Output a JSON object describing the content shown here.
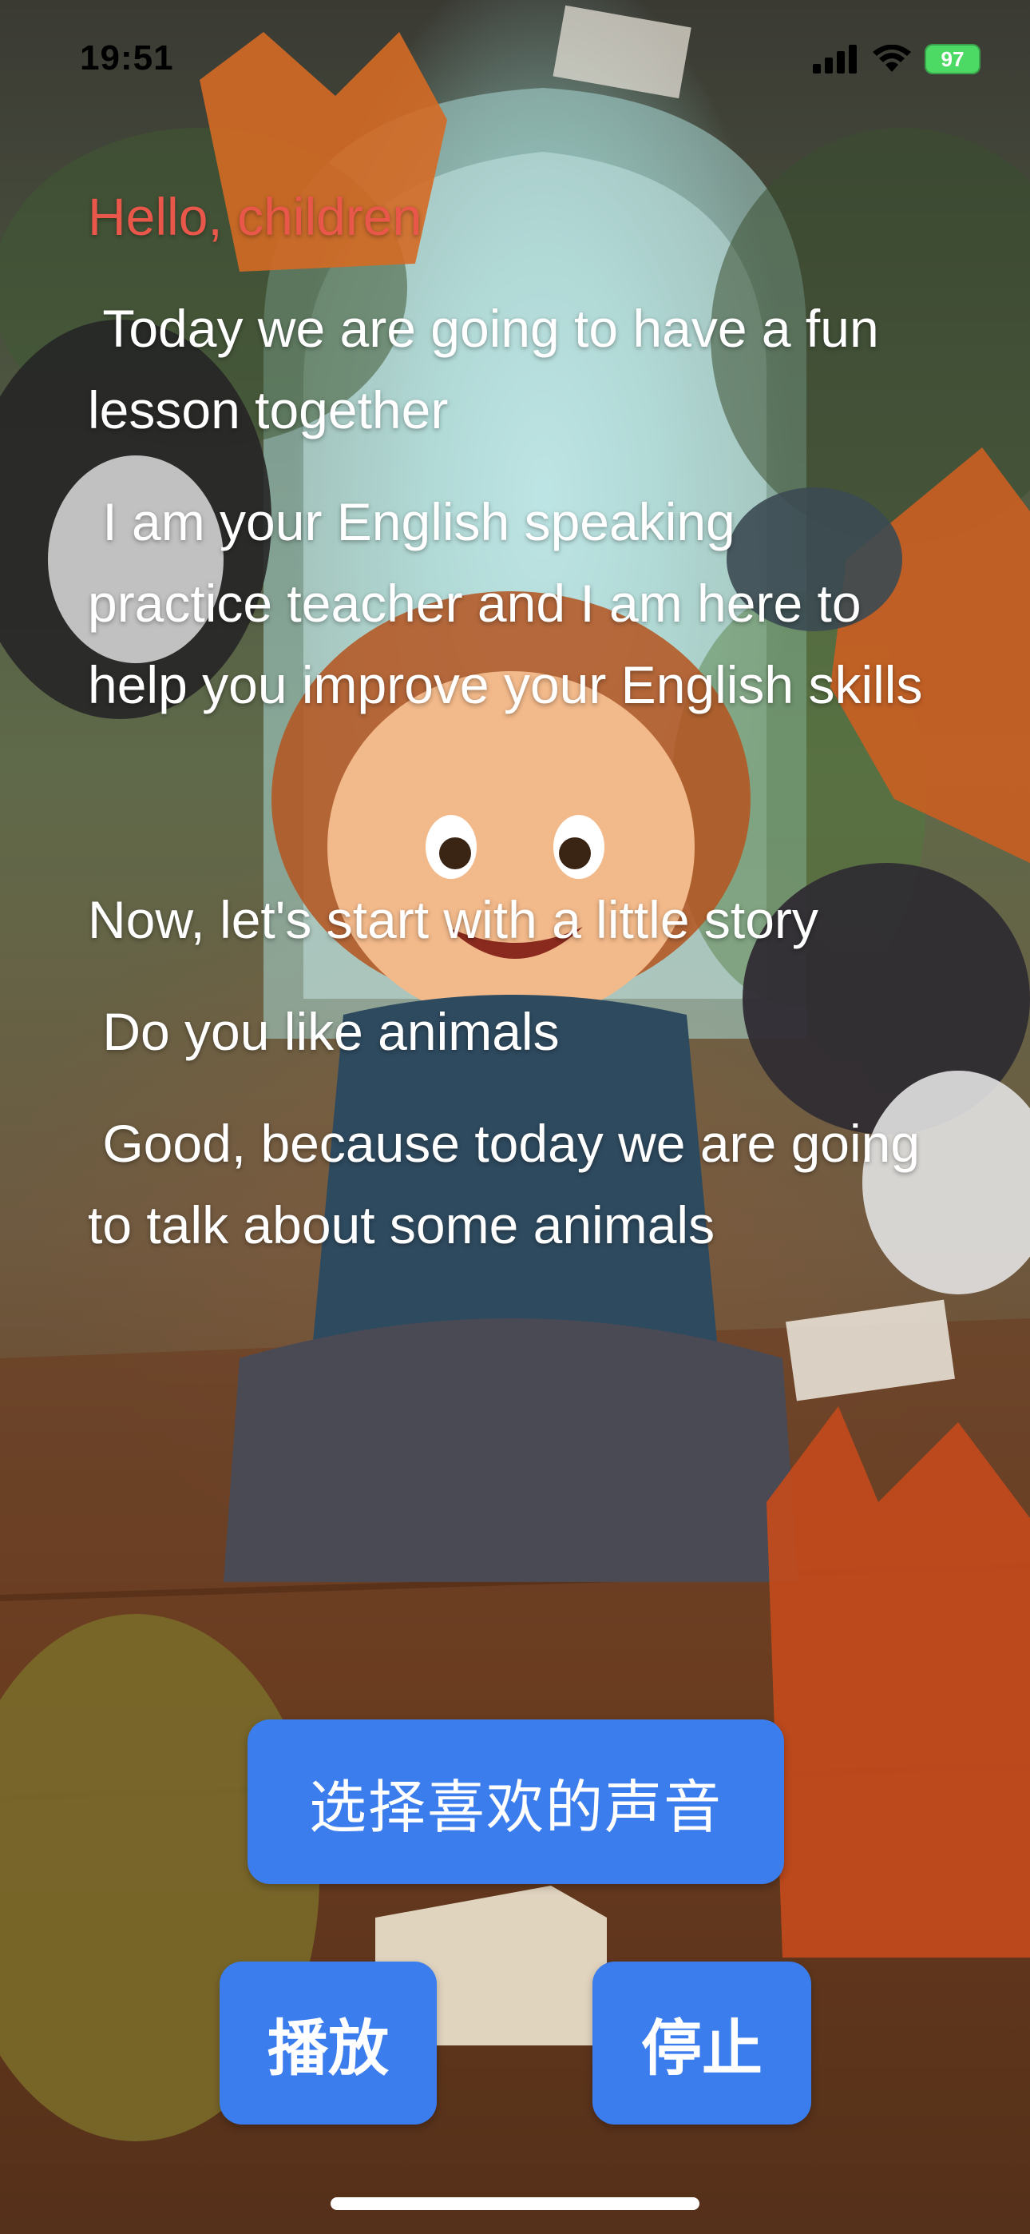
{
  "status_bar": {
    "time": "19:51",
    "battery_level": "97"
  },
  "lesson": {
    "greeting": "Hello, children",
    "paragraph_1": " Today we are going to have a fun lesson together",
    "paragraph_2": " I am your English speaking practice teacher and I am here to help you improve your English skills",
    "paragraph_3": "Now, let's start with a little story",
    "paragraph_4": " Do you like animals",
    "paragraph_5": " Good, because today we are going to talk about some animals"
  },
  "controls": {
    "select_voice_label": "选择喜欢的声音",
    "play_label": "播放",
    "stop_label": "停止"
  },
  "colors": {
    "button_blue": "#3b7ded",
    "greeting_red": "#e8574a",
    "battery_green": "#4cd964"
  }
}
